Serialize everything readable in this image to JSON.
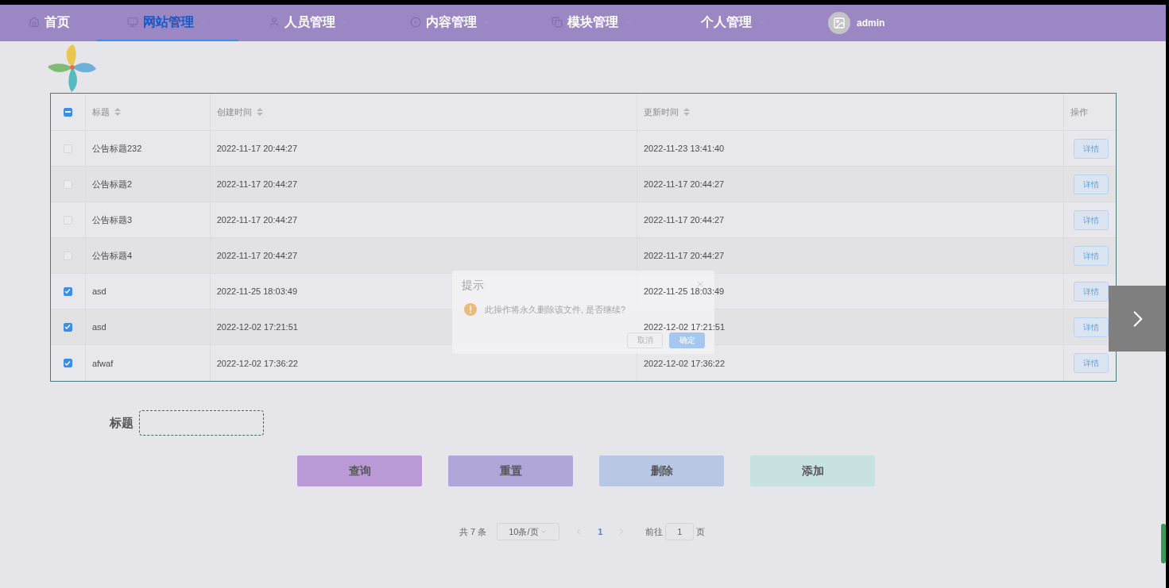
{
  "nav": {
    "items": [
      {
        "label": "首页",
        "selected": false,
        "caret": false
      },
      {
        "label": "网站管理",
        "selected": true,
        "caret": true
      },
      {
        "label": "人员管理",
        "selected": false,
        "caret": true
      },
      {
        "label": "内容管理",
        "selected": false,
        "caret": true
      },
      {
        "label": "模块管理",
        "selected": false,
        "caret": true
      },
      {
        "label": "个人管理",
        "selected": false,
        "caret": true
      }
    ],
    "user": {
      "name": "admin"
    }
  },
  "table": {
    "header_checkbox": {
      "indeterminate": true
    },
    "columns": [
      {
        "label": "标题",
        "sortable": true
      },
      {
        "label": "创建时间",
        "sortable": true
      },
      {
        "label": "更新时间",
        "sortable": true
      },
      {
        "label": "操作",
        "sortable": false
      }
    ],
    "rows": [
      {
        "checked": false,
        "title": "公告标题232",
        "created": "2022-11-17 20:44:27",
        "updated": "2022-11-23 13:41:40",
        "action": "详情"
      },
      {
        "checked": false,
        "title": "公告标题2",
        "created": "2022-11-17 20:44:27",
        "updated": "2022-11-17 20:44:27",
        "action": "详情"
      },
      {
        "checked": false,
        "title": "公告标题3",
        "created": "2022-11-17 20:44:27",
        "updated": "2022-11-17 20:44:27",
        "action": "详情"
      },
      {
        "checked": false,
        "title": "公告标题4",
        "created": "2022-11-17 20:44:27",
        "updated": "2022-11-17 20:44:27",
        "action": "详情"
      },
      {
        "checked": true,
        "title": "asd",
        "created": "2022-11-25 18:03:49",
        "updated": "2022-11-25 18:03:49",
        "action": "详情"
      },
      {
        "checked": true,
        "title": "asd",
        "created": "2022-12-02 17:21:51",
        "updated": "2022-12-02 17:21:51",
        "action": "详情"
      },
      {
        "checked": true,
        "title": "afwaf",
        "created": "2022-12-02 17:36:22",
        "updated": "2022-12-02 17:36:22",
        "action": "详情"
      }
    ]
  },
  "search": {
    "label": "标题"
  },
  "buttons": [
    {
      "label": "查询",
      "color": "#b99ad6"
    },
    {
      "label": "重置",
      "color": "#b0a6da"
    },
    {
      "label": "删除",
      "color": "#b8c8e4"
    },
    {
      "label": "添加",
      "color": "#c8e2e2"
    }
  ],
  "pagination": {
    "total": "共 7 条",
    "page_size": "10条/页",
    "pages": [
      {
        "label": "1",
        "selected": true
      }
    ],
    "goto_label": "前往",
    "goto_value": "1",
    "goto_suffix": "页"
  },
  "dialog": {
    "title": "提示",
    "message": "此操作将永久删除该文件, 是否继续?",
    "buttons": [
      {
        "label": "取消",
        "kind": "secondary"
      },
      {
        "label": "确定",
        "kind": "primary"
      }
    ]
  }
}
